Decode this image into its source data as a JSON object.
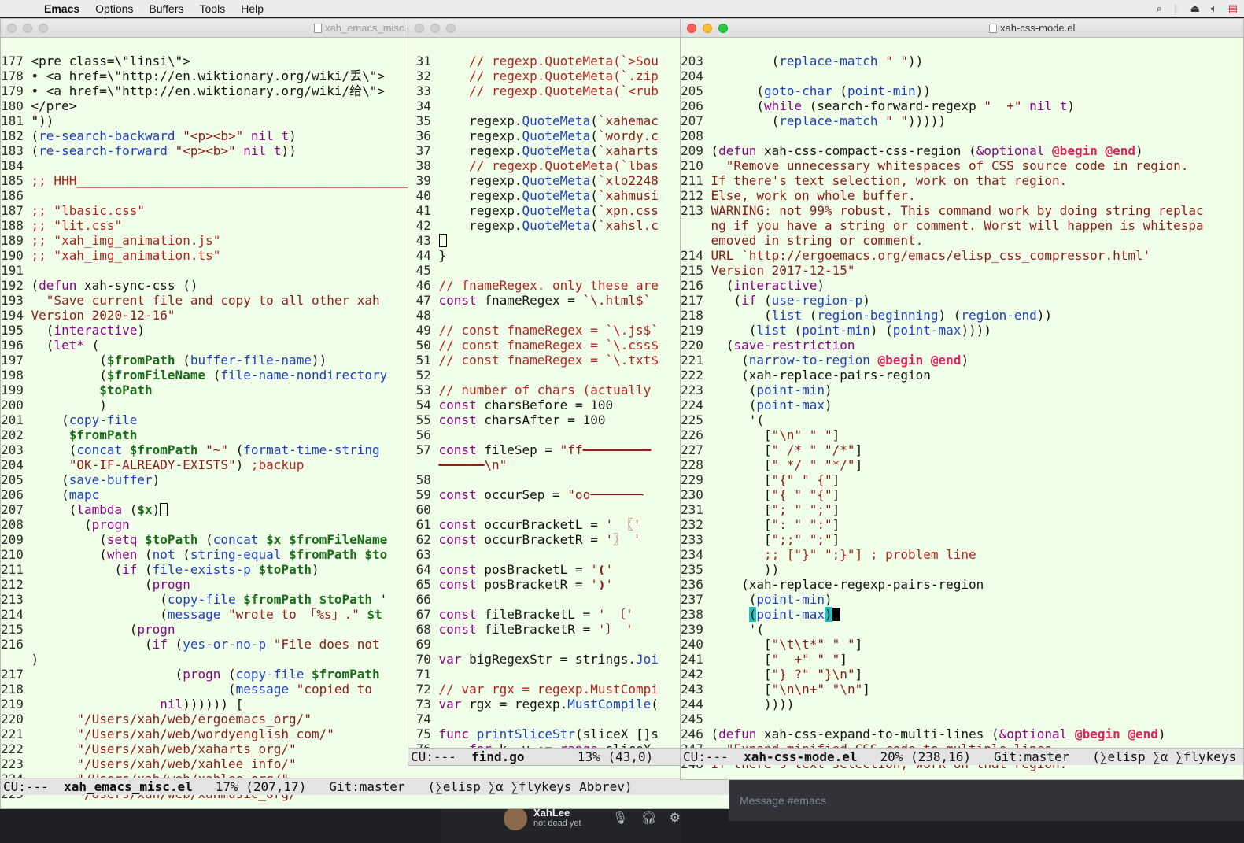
{
  "menubar": {
    "app": "Emacs",
    "items": [
      "Options",
      "Buffers",
      "Tools",
      "Help"
    ],
    "tray_icons": [
      "search-icon",
      "bluetooth-icon",
      "eject-icon",
      "volume-icon",
      "flag-icon"
    ]
  },
  "win1": {
    "title": "xah_emacs_misc.el",
    "modeline": {
      "prefix": "CU:---  ",
      "buffer": "xah_emacs_misc.el",
      "rest": "   17% (207,17)   Git:master   (∑elisp ∑α ∑flykeys Abbrev)"
    }
  },
  "win2": {
    "title": "",
    "modeline": {
      "prefix": "CU:---  ",
      "buffer": "find.go",
      "rest": "       13% (43,0)"
    }
  },
  "win3": {
    "title": "xah-css-mode.el",
    "modeline": {
      "prefix": "CU:---  ",
      "buffer": "xah-css-mode.el",
      "rest": "   20% (238,16)   Git:master   (∑elisp ∑α ∑flykeys"
    }
  },
  "chat": {
    "input_placeholder": "Message #emacs",
    "user_name": "XahLee",
    "user_status": "not dead yet"
  }
}
